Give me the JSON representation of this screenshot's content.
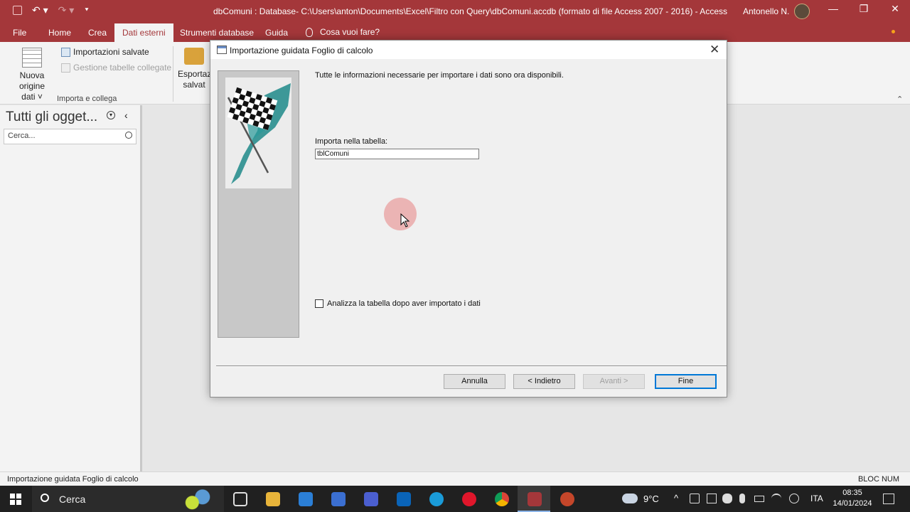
{
  "window": {
    "title": "dbComuni : Database- C:\\Users\\anton\\Documents\\Excel\\Filtro con Query\\dbComuni.accdb (formato di file Access 2007 - 2016)  -  Access",
    "user": "Antonello N.",
    "minimize": "—",
    "restore": "❐",
    "close": "✕",
    "save_icon": "save-icon",
    "undo": "↶ ▾",
    "redo": "↷ ▾",
    "customize": "⯆"
  },
  "tabs": {
    "file": "File",
    "home": "Home",
    "crea": "Crea",
    "dati_esterni": "Dati esterni",
    "strumenti": "Strumenti database",
    "guida": "Guida",
    "tellme": "Cosa vuoi fare?"
  },
  "ribbon": {
    "nuova_origine": "Nuova origine",
    "dati": "dati ˅",
    "importazioni_salvate": "Importazioni salvate",
    "gestione_tabelle": "Gestione tabelle collegate",
    "group_label": "Importa e collega",
    "esportaz": "Esportaz",
    "salvat": "salvat"
  },
  "nav": {
    "title": "Tutti gli ogget...",
    "search_placeholder": "Cerca...",
    "close": "‹"
  },
  "dialog": {
    "title": "Importazione guidata Foglio di calcolo",
    "close": "✕",
    "message": "Tutte le informazioni necessarie per importare i dati sono ora disponibili.",
    "import_label": "Importa nella tabella:",
    "table_name": "tblComuni",
    "analyze_label": "Analizza la tabella dopo aver importato i dati",
    "analyze_checked": false,
    "buttons": {
      "annulla": "Annulla",
      "indietro": "< Indietro",
      "avanti": "Avanti >",
      "fine": "Fine"
    }
  },
  "statusbar": {
    "left": "Importazione guidata Foglio di calcolo",
    "right": "BLOC NUM"
  },
  "taskbar": {
    "search": "Cerca",
    "weather": "9°C",
    "lang": "ITA",
    "time": "08:35",
    "date": "14/01/2024"
  },
  "colors": {
    "access_red": "#a4373a",
    "default_button_border": "#0078d7"
  }
}
